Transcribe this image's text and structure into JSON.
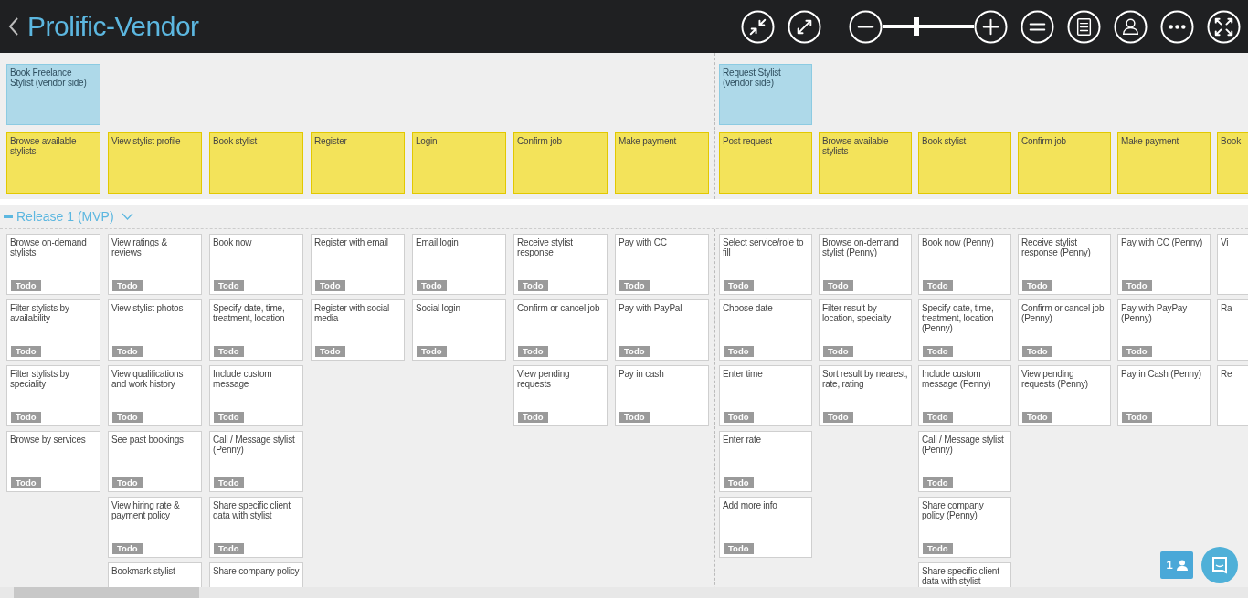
{
  "header": {
    "title": "Prolific-Vendor"
  },
  "zoom_slider": {
    "level": 0.37
  },
  "activities": [
    {
      "title": "Book Freelance Stylist (vendor side)",
      "steps": [
        {
          "title": "Browse available stylists",
          "stories": [
            {
              "title": "Browse on-demand stylists",
              "status": "Todo"
            },
            {
              "title": "Filter stylists by availability",
              "status": "Todo"
            },
            {
              "title": "Filter stylists by speciality",
              "status": "Todo"
            },
            {
              "title": "Browse by services",
              "status": "Todo"
            }
          ]
        },
        {
          "title": "View stylist profile",
          "stories": [
            {
              "title": "View ratings & reviews",
              "status": "Todo"
            },
            {
              "title": "View stylist photos",
              "status": "Todo"
            },
            {
              "title": "View qualifications and work history",
              "status": "Todo"
            },
            {
              "title": "See past bookings",
              "status": "Todo"
            },
            {
              "title": "View hiring rate & payment policy",
              "status": "Todo"
            },
            {
              "title": "Bookmark stylist"
            }
          ]
        },
        {
          "title": "Book stylist",
          "stories": [
            {
              "title": "Book now",
              "status": "Todo"
            },
            {
              "title": "Specify date, time, treatment, location",
              "status": "Todo"
            },
            {
              "title": "Include custom message",
              "status": "Todo"
            },
            {
              "title": "Call / Message stylist (Penny)",
              "status": "Todo"
            },
            {
              "title": "Share specific client data with stylist",
              "status": "Todo"
            },
            {
              "title": "Share company policy"
            }
          ]
        },
        {
          "title": "Register",
          "stories": [
            {
              "title": "Register with email",
              "status": "Todo"
            },
            {
              "title": "Register with social media",
              "status": "Todo"
            }
          ]
        },
        {
          "title": "Login",
          "stories": [
            {
              "title": "Email login",
              "status": "Todo"
            },
            {
              "title": "Social login",
              "status": "Todo"
            }
          ]
        },
        {
          "title": "Confirm job",
          "stories": [
            {
              "title": "Receive stylist response",
              "status": "Todo"
            },
            {
              "title": "Confirm or cancel job",
              "status": "Todo"
            },
            {
              "title": "View pending requests",
              "status": "Todo"
            }
          ]
        },
        {
          "title": "Make payment",
          "stories": [
            {
              "title": "Pay with CC",
              "status": "Todo"
            },
            {
              "title": "Pay with PayPal",
              "status": "Todo"
            },
            {
              "title": "Pay in cash",
              "status": "Todo"
            }
          ]
        }
      ]
    },
    {
      "title": "Request Stylist (vendor side)",
      "steps": [
        {
          "title": "Post request",
          "stories": [
            {
              "title": "Select service/role to fill",
              "status": "Todo"
            },
            {
              "title": "Choose date",
              "status": "Todo"
            },
            {
              "title": "Enter time",
              "status": "Todo"
            },
            {
              "title": "Enter rate",
              "status": "Todo"
            },
            {
              "title": "Add more info",
              "status": "Todo"
            }
          ]
        },
        {
          "title": "Browse available stylists",
          "stories": [
            {
              "title": "Browse on-demand stylist (Penny)",
              "status": "Todo"
            },
            {
              "title": "Filter result by location, specialty",
              "status": "Todo"
            },
            {
              "title": "Sort result by nearest, rate, rating",
              "status": "Todo"
            }
          ]
        },
        {
          "title": "Book stylist",
          "stories": [
            {
              "title": "Book now (Penny)",
              "status": "Todo"
            },
            {
              "title": "Specify date, time, treatment, location (Penny)",
              "status": "Todo"
            },
            {
              "title": "Include custom message (Penny)",
              "status": "Todo"
            },
            {
              "title": "Call / Message stylist (Penny)",
              "status": "Todo"
            },
            {
              "title": "Share company policy (Penny)",
              "status": "Todo"
            },
            {
              "title": "Share specific client data with stylist"
            }
          ]
        },
        {
          "title": "Confirm job",
          "stories": [
            {
              "title": "Receive stylist response (Penny)",
              "status": "Todo"
            },
            {
              "title": "Confirm or cancel job (Penny)",
              "status": "Todo"
            },
            {
              "title": "View pending requests (Penny)",
              "status": "Todo"
            }
          ]
        },
        {
          "title": "Make payment",
          "stories": [
            {
              "title": "Pay with CC (Penny)",
              "status": "Todo"
            },
            {
              "title": "Pay with PayPay (Penny)",
              "status": "Todo"
            },
            {
              "title": "Pay in Cash (Penny)",
              "status": "Todo"
            }
          ]
        },
        {
          "title": "Book",
          "stories": [
            {
              "title": "Vi"
            },
            {
              "title": "Ra"
            },
            {
              "title": "Re"
            }
          ]
        }
      ]
    }
  ],
  "release": {
    "title": "Release 1 (MVP)",
    "expanded": true
  },
  "online_users": {
    "count": "1"
  }
}
